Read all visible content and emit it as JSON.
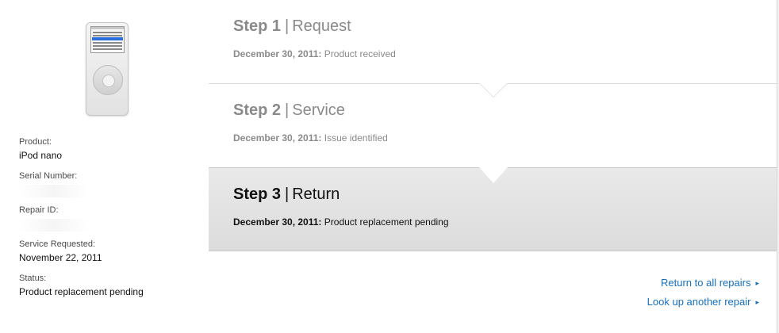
{
  "product_label": "Product:",
  "product_value": "iPod nano",
  "serial_label": "Serial Number:",
  "repair_id_label": "Repair ID:",
  "service_requested_label": "Service Requested:",
  "service_requested_value": "November 22, 2011",
  "status_label": "Status:",
  "status_value": "Product replacement pending",
  "steps": [
    {
      "num": "Step 1",
      "sep": "|",
      "name": "Request",
      "date": "December 30, 2011:",
      "desc": "Product received"
    },
    {
      "num": "Step 2",
      "sep": "|",
      "name": "Service",
      "date": "December 30, 2011:",
      "desc": "Issue identified"
    },
    {
      "num": "Step 3",
      "sep": "|",
      "name": "Return",
      "date": "December 30, 2011:",
      "desc": "Product replacement pending"
    }
  ],
  "links": {
    "return_all": "Return to all repairs",
    "lookup": "Look up another repair",
    "arrow": "▸"
  },
  "colors": {
    "link": "#1a6fb6",
    "active_step_bg": "#dcdcdc",
    "inactive_text": "#8a8a8a"
  },
  "icons": [
    "ipod-nano-image",
    "chevron-right-icon"
  ]
}
